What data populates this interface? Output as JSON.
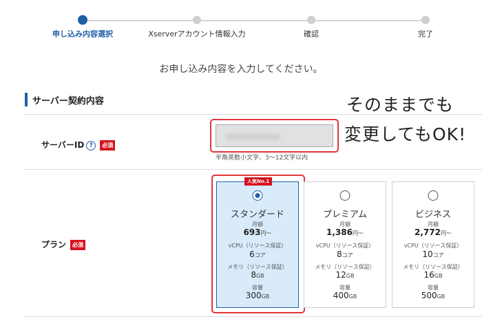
{
  "stepper": {
    "steps": [
      {
        "label": "申し込み内容選択"
      },
      {
        "label": "Xserverアカウント情報入力"
      },
      {
        "label": "確認"
      },
      {
        "label": "完了"
      }
    ]
  },
  "page_subtitle": "お申し込み内容を入力してください。",
  "section": {
    "title": "サーバー契約内容"
  },
  "server_id": {
    "label": "サーバーID",
    "help": "?",
    "required": "必須",
    "value": "xxxxxxxxxxxx",
    "hint": "半角英数小文字、3～12文字以内"
  },
  "note": {
    "line1": "そのままでも",
    "line2": "変更してもOK!"
  },
  "plan": {
    "label": "プラン",
    "required": "必須",
    "popular_badge": "人気No.1",
    "price_caption": "月額",
    "price_unit": "円～",
    "vcpu_caption": "vCPU（リソース保証）",
    "vcpu_unit": "コア",
    "memory_caption": "メモリ（リソース保証）",
    "storage_caption": "容量",
    "size_unit": "GB",
    "options": [
      {
        "name": "スタンダード",
        "price": "693",
        "vcpu": "6",
        "memory": "8",
        "storage": "300"
      },
      {
        "name": "プレミアム",
        "price": "1,386",
        "vcpu": "8",
        "memory": "12",
        "storage": "400"
      },
      {
        "name": "ビジネス",
        "price": "2,772",
        "vcpu": "10",
        "memory": "16",
        "storage": "500"
      }
    ],
    "selected": "スタンダード"
  },
  "colors": {
    "accent": "#1f5fa6",
    "required": "#d4141f",
    "highlight": "#e0363c",
    "selected_bg": "#d9ebfb"
  }
}
